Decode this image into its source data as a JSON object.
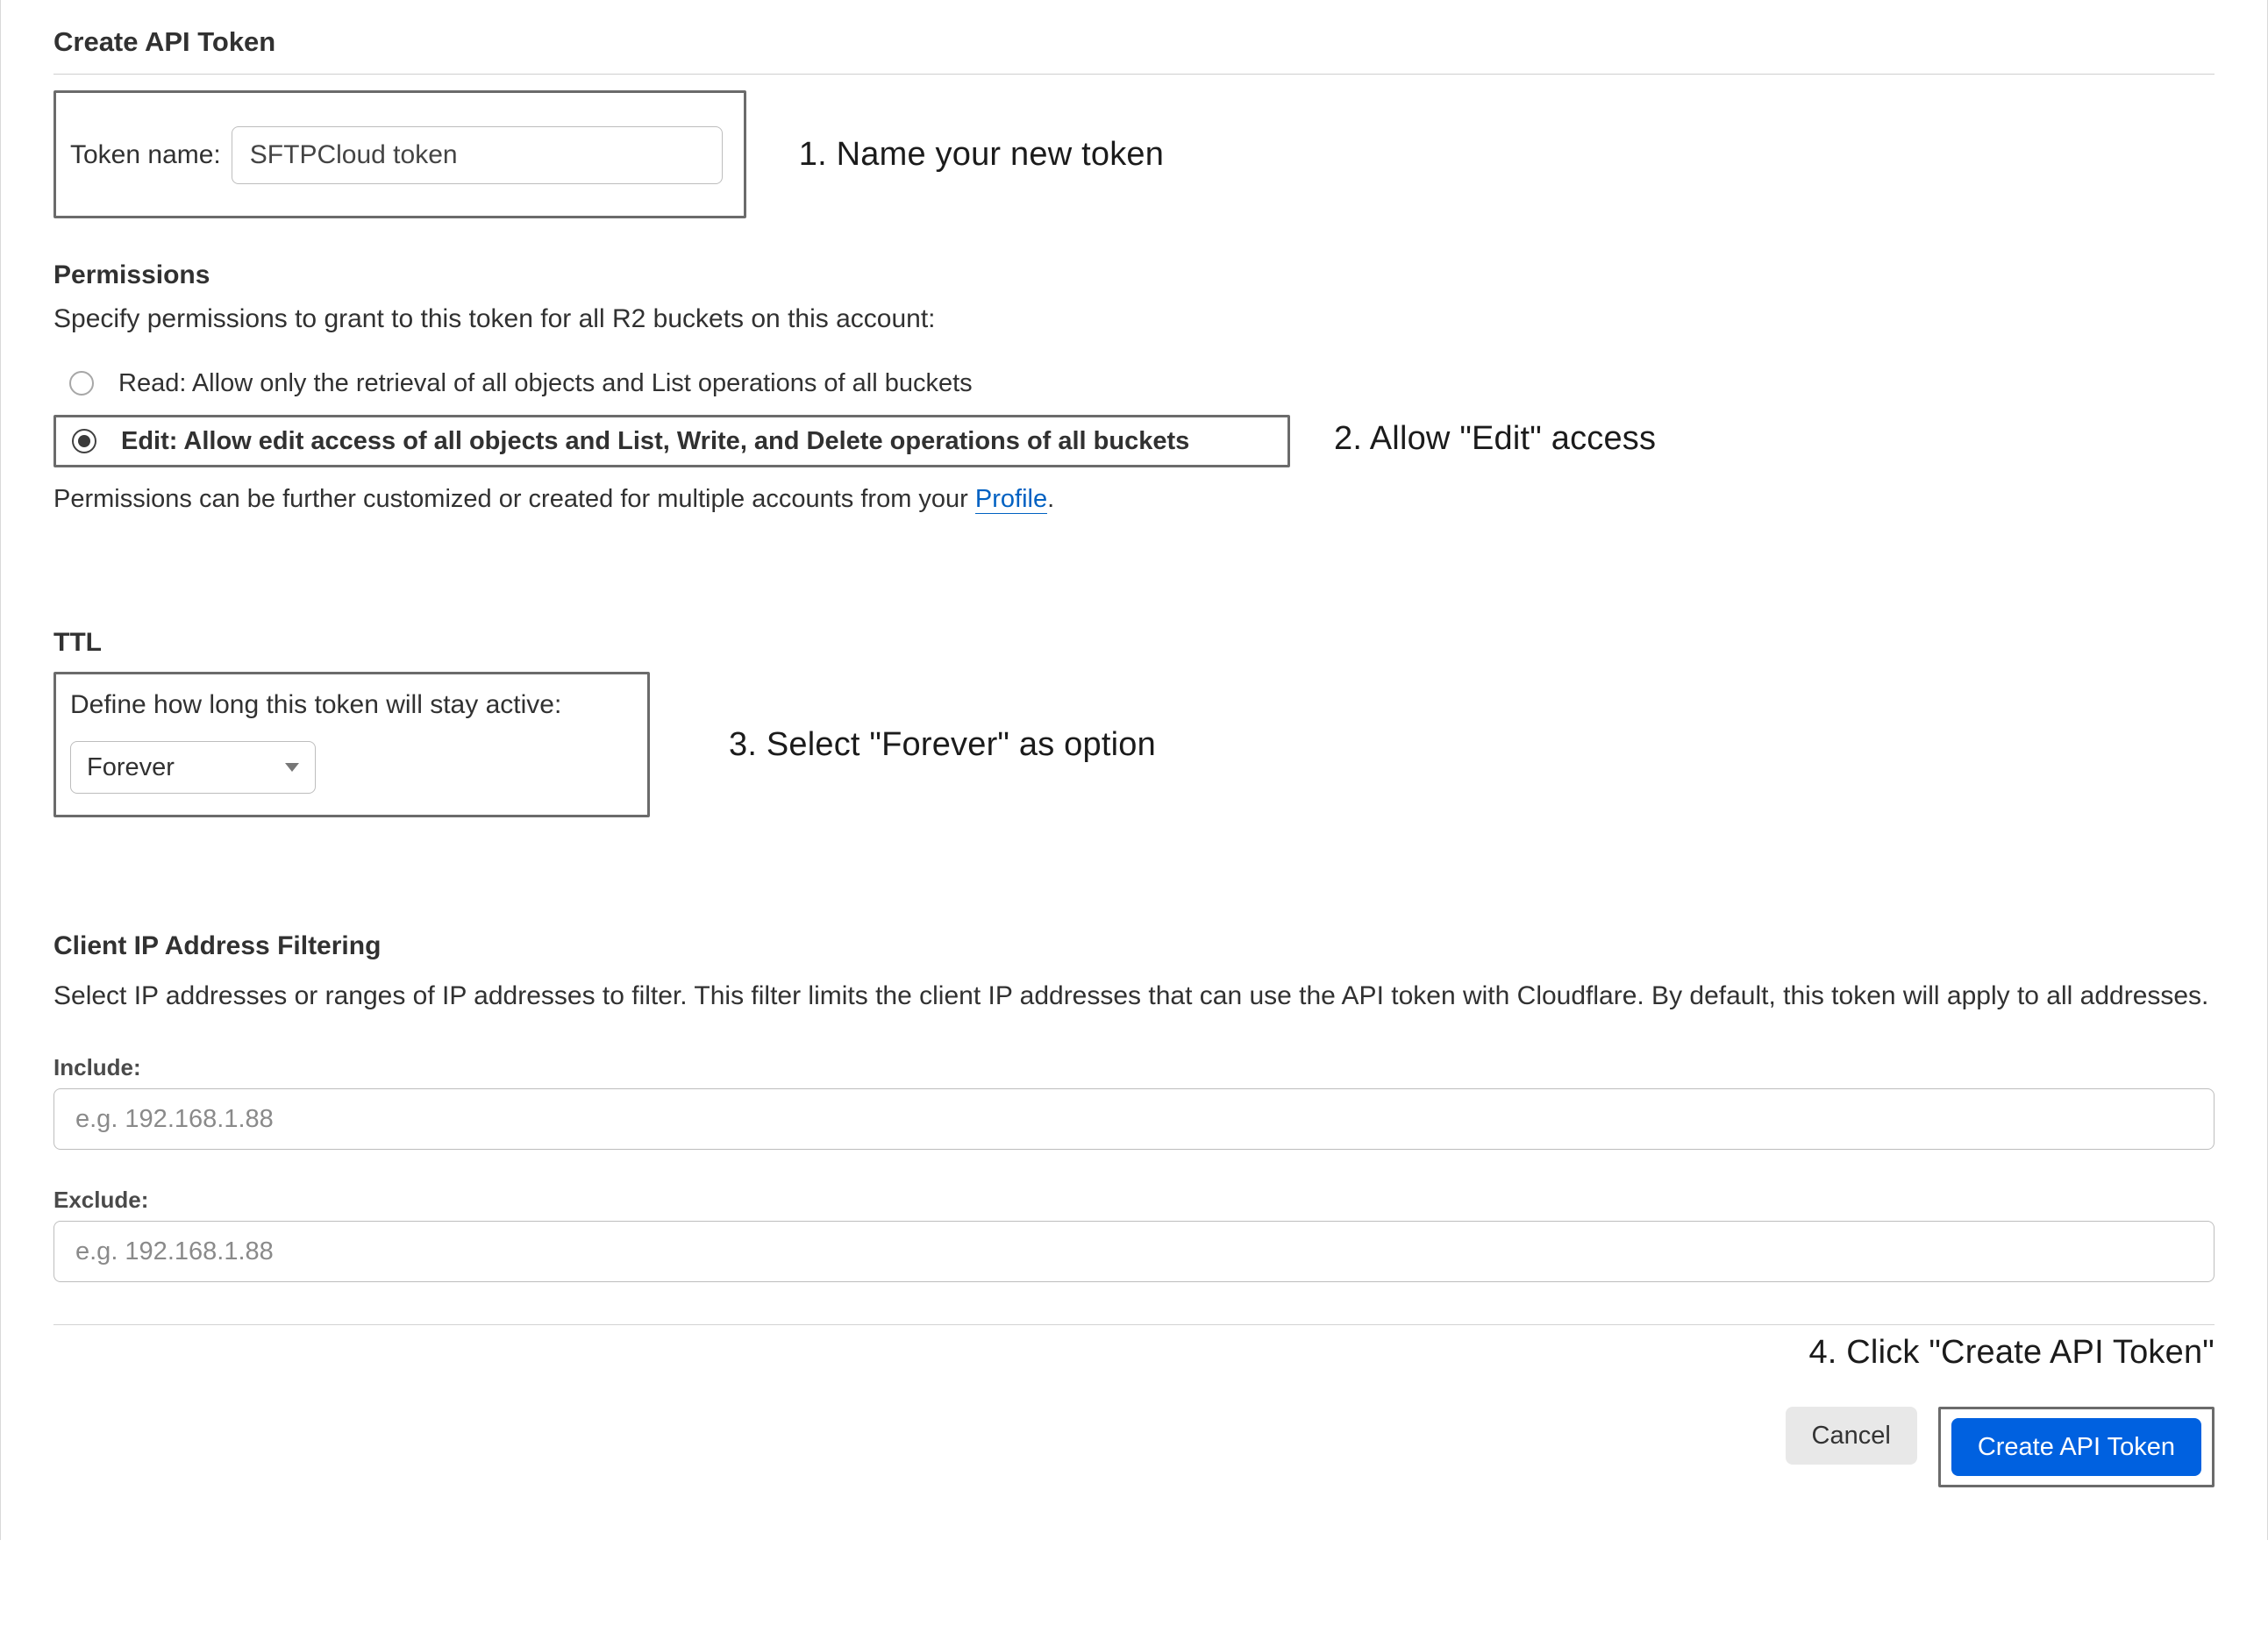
{
  "page": {
    "title": "Create API Token"
  },
  "token_name": {
    "label": "Token name:",
    "value": "SFTPCloud token"
  },
  "annotations": {
    "step1": "1. Name your new token",
    "step2": "2. Allow \"Edit\" access",
    "step3": "3. Select \"Forever\" as option",
    "step4": "4. Click \"Create API Token\""
  },
  "permissions": {
    "heading": "Permissions",
    "description": "Specify permissions to grant to this token for all R2 buckets on this account:",
    "read_label": "Read: Allow only the retrieval of all objects and List operations of all buckets",
    "edit_label": "Edit: Allow edit access of all objects and List, Write, and Delete operations of all buckets",
    "profile_prefix": "Permissions can be further customized or created for multiple accounts from your ",
    "profile_link": "Profile",
    "profile_suffix": "."
  },
  "ttl": {
    "heading": "TTL",
    "description": "Define how long this token will stay active:",
    "selected": "Forever"
  },
  "ip_filter": {
    "heading": "Client IP Address Filtering",
    "description": "Select IP addresses or ranges of IP addresses to filter. This filter limits the client IP addresses that can use the API token with Cloudflare. By default, this token will apply to all addresses.",
    "include_label": "Include:",
    "include_placeholder": "e.g. 192.168.1.88",
    "exclude_label": "Exclude:",
    "exclude_placeholder": "e.g. 192.168.1.88"
  },
  "buttons": {
    "cancel": "Cancel",
    "create": "Create API Token"
  }
}
